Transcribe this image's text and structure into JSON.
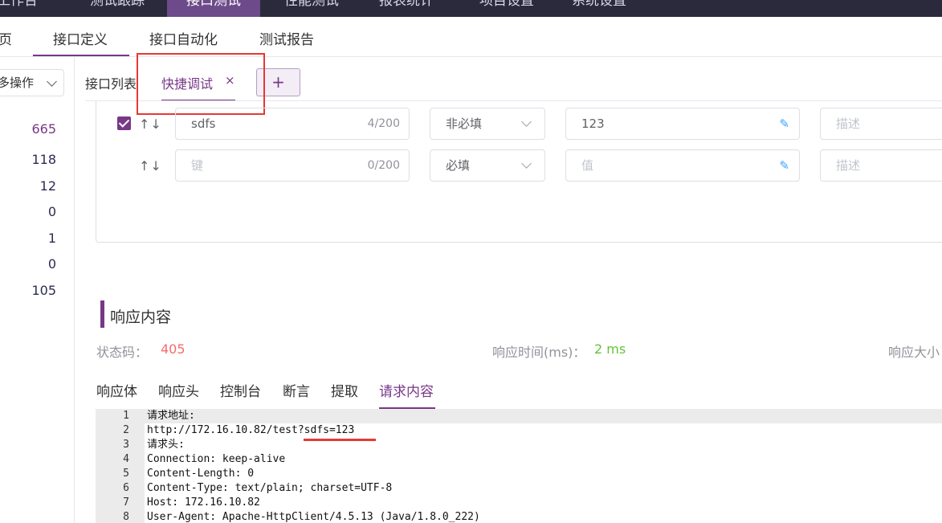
{
  "topnav": {
    "items": [
      "工作台",
      "测试跟踪",
      "接口测试",
      "性能测试",
      "报表统计",
      "项目设置",
      "系统设置"
    ]
  },
  "subnav": {
    "items": [
      "页",
      "接口定义",
      "接口自动化",
      "测试报告"
    ]
  },
  "left": {
    "more_label": "多操作",
    "counts": [
      "665",
      "118",
      "12",
      "0",
      "1",
      "0",
      "105"
    ]
  },
  "tabs": {
    "list_label": "接口列表",
    "quick_label": "快捷调试",
    "close": "×",
    "add": "+"
  },
  "params": {
    "rows": [
      {
        "checked": true,
        "key": "sdfs",
        "key_count": "4/200",
        "required": "非必填",
        "value": "123",
        "desc": "描述"
      },
      {
        "checked": false,
        "key": "键",
        "key_count": "0/200",
        "required": "必填",
        "value": "值",
        "desc": "描述"
      }
    ],
    "arrows": "↑↓"
  },
  "response": {
    "title": "响应内容",
    "status_label": "状态码：",
    "status_value": "405",
    "time_label": "响应时间(ms)：",
    "time_value": "2 ms",
    "size_label": "响应大小"
  },
  "response_tabs": [
    "响应体",
    "响应头",
    "控制台",
    "断言",
    "提取",
    "请求内容"
  ],
  "code_lines": [
    {
      "n": "1",
      "t": "请求地址:"
    },
    {
      "n": "2",
      "t": "http://172.16.10.82/test?sdfs=123"
    },
    {
      "n": "3",
      "t": "请求头:"
    },
    {
      "n": "4",
      "t": "Connection: keep-alive"
    },
    {
      "n": "5",
      "t": "Content-Length: 0"
    },
    {
      "n": "6",
      "t": "Content-Type: text/plain; charset=UTF-8"
    },
    {
      "n": "7",
      "t": "Host: 172.16.10.82"
    },
    {
      "n": "8",
      "t": "User-Agent: Apache-HttpClient/4.5.13 (Java/1.8.0_222)"
    }
  ],
  "colors": {
    "accent": "#783887",
    "nav_bg": "#2b2a3d",
    "status_error": "#f56c6c",
    "time_ok": "#67c23a",
    "highlight": "#e53935"
  }
}
